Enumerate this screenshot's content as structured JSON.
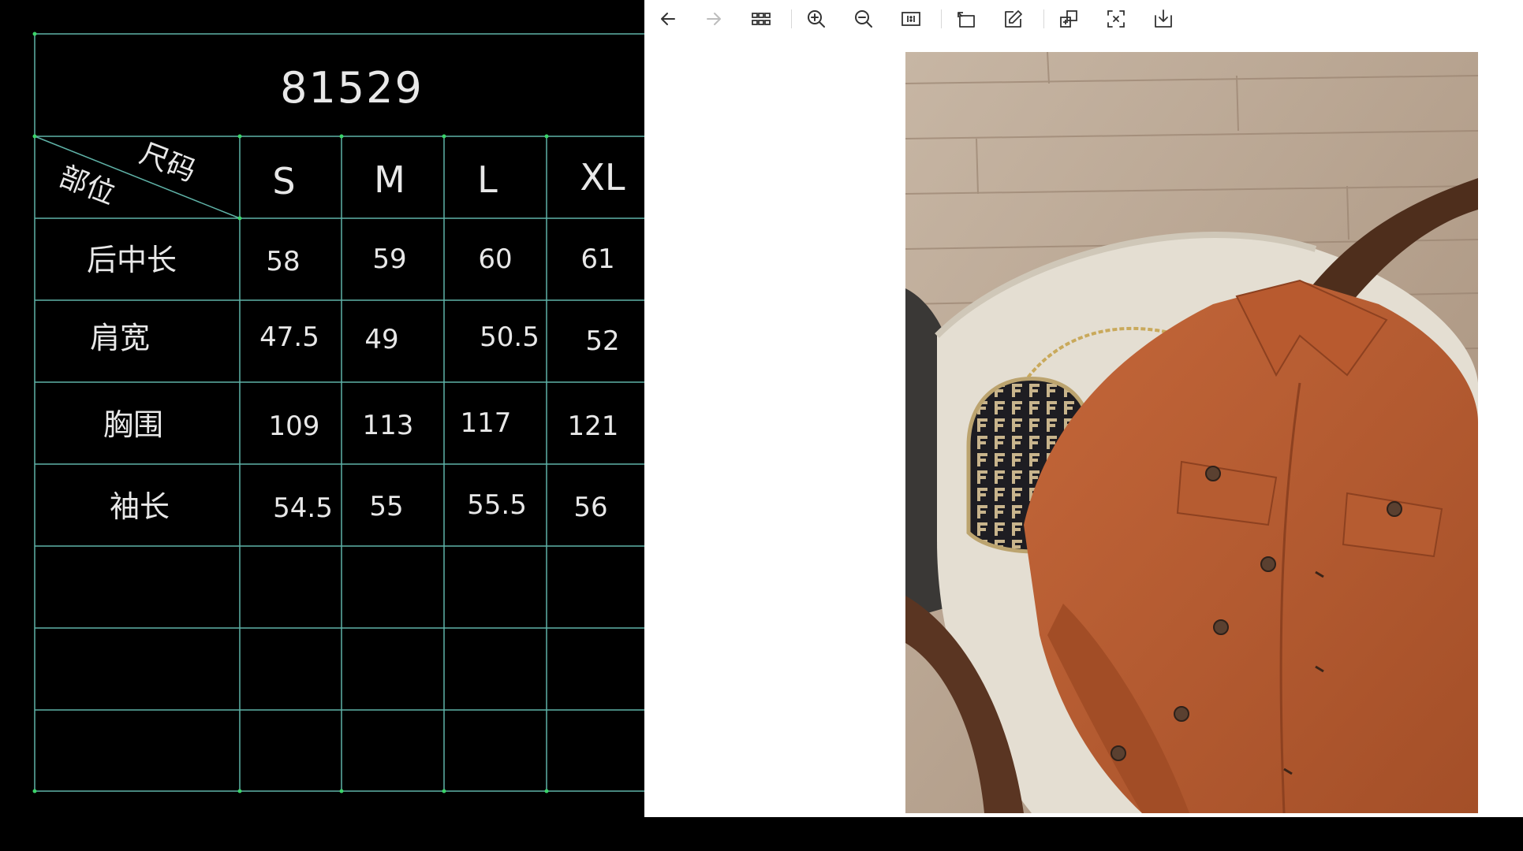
{
  "size_chart": {
    "title": "81529",
    "corner_top": "尺码",
    "corner_bottom": "部位",
    "sizes": [
      "S",
      "M",
      "L",
      "XL"
    ],
    "rows": [
      {
        "label": "后中长",
        "values": [
          "58",
          "59",
          "60",
          "61"
        ]
      },
      {
        "label": "肩宽",
        "values": [
          "47.5",
          "49",
          "50.5",
          "52"
        ]
      },
      {
        "label": "胸围",
        "values": [
          "109",
          "113",
          "117",
          "121"
        ]
      },
      {
        "label": "袖长",
        "values": [
          "54.5",
          "55",
          "55.5",
          "56"
        ]
      }
    ],
    "line_color": "#5fb3a8",
    "text_color": "#e8e8e8"
  },
  "viewer": {
    "toolbar": [
      {
        "name": "back-button",
        "icon": "arrow-left-icon",
        "enabled": true
      },
      {
        "name": "forward-button",
        "icon": "arrow-right-icon",
        "enabled": false
      },
      {
        "name": "grid-view-button",
        "icon": "grid-icon",
        "enabled": true
      },
      {
        "name": "zoom-in-button",
        "icon": "zoom-in-icon",
        "enabled": true
      },
      {
        "name": "zoom-out-button",
        "icon": "zoom-out-icon",
        "enabled": true
      },
      {
        "name": "actual-size-button",
        "icon": "actual-size-icon",
        "enabled": true
      },
      {
        "name": "rotate-button",
        "icon": "rotate-icon",
        "enabled": true
      },
      {
        "name": "edit-button",
        "icon": "edit-icon",
        "enabled": true
      },
      {
        "name": "image-compare-button",
        "icon": "image-compare-icon",
        "enabled": true
      },
      {
        "name": "fit-screen-button",
        "icon": "fit-screen-icon",
        "enabled": true
      },
      {
        "name": "download-button",
        "icon": "download-icon",
        "enabled": true
      }
    ],
    "photo_colors": {
      "floor": "#b5a18e",
      "jacket": "#b35a30",
      "chair": "#4e2e1c",
      "cushion": "#e4ded2"
    }
  }
}
